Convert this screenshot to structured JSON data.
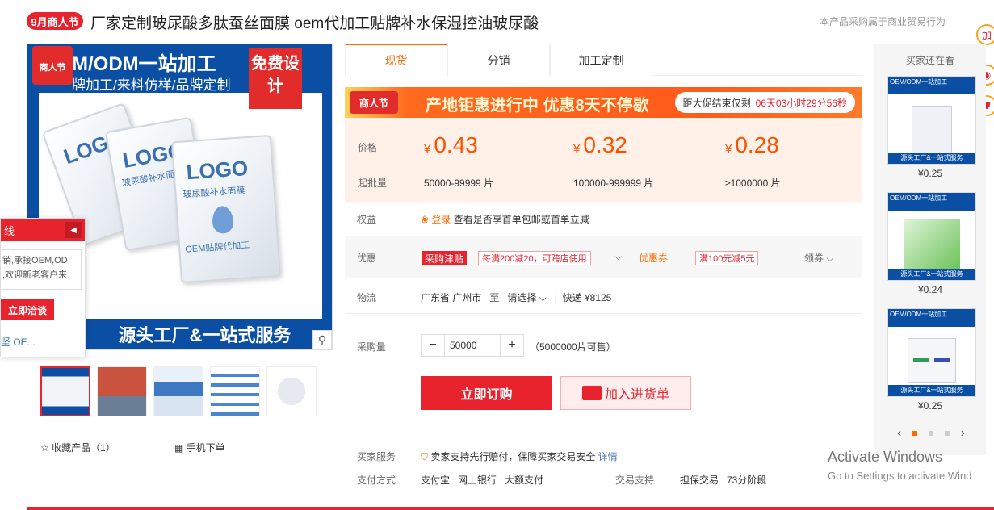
{
  "header": {
    "event_badge": "9月商人节",
    "title": "厂家定制玻尿酸多肽蚕丝面膜 oem代加工贴牌补水保湿控油玻尿酸",
    "trade_note": "本产品采购属于商业贸易行为",
    "float_label": "加"
  },
  "main_image": {
    "badge": "商人节",
    "top_text": "M/ODM一站加工",
    "top_sub": "牌加工/来料仿样/品牌定制",
    "free_text": "免费设计",
    "sachet_logo": "LOGO",
    "sachet_sub": "玻尿酸补水面膜",
    "sachet_oem": "OEM贴牌代加工",
    "bottom_text": "源头工厂&一站式服务"
  },
  "popup": {
    "title": "线",
    "text_line1": "销,承接OEM,OD",
    "text_line2": ",欢迎新老客户来",
    "button": "立即洽谈",
    "footer": "坚 OE..."
  },
  "thumbs": [
    "thumb-1",
    "thumb-2",
    "thumb-3",
    "thumb-4",
    "thumb-5"
  ],
  "actions": {
    "favorite": "收藏产品（1）",
    "mobile_order": "手机下单"
  },
  "tabs": [
    {
      "label": "现货",
      "active": true
    },
    {
      "label": "分销",
      "active": false
    },
    {
      "label": "加工定制",
      "active": false
    }
  ],
  "promo": {
    "badge": "商人节",
    "text": "产地钜惠进行中 优惠8天不停歇",
    "timer_label": "距大促结束仅剩",
    "timer_value": "06天03小时29分56秒"
  },
  "price": {
    "price_label": "价格",
    "qty_label": "起批量",
    "currency": "¥",
    "tiers": [
      {
        "price": "0.43",
        "qty": "50000-99999 片"
      },
      {
        "price": "0.32",
        "qty": "100000-999999 片"
      },
      {
        "price": "0.28",
        "qty": "≥1000000 片"
      }
    ]
  },
  "rights": {
    "label": "权益",
    "link": "登录",
    "text": "查看是否享首单包邮或首单立减"
  },
  "discount": {
    "label": "优惠",
    "tag": "采购津贴",
    "coupon1": "每满200减20，可跨店使用",
    "coupon_label": "优惠券",
    "coupon2": "满100元减5元",
    "claim": "领券"
  },
  "logistics": {
    "label": "物流",
    "from": "广东省 广州市",
    "to_label": "至",
    "to": "请选择",
    "shipping": "快递 ¥8125"
  },
  "quantity": {
    "label": "采购量",
    "value": "50000",
    "stock": "（5000000片可售）"
  },
  "buttons": {
    "buy": "立即订购",
    "cart": "加入进货单"
  },
  "service": {
    "label": "买家服务",
    "text": "卖家支持先行赔付，保障买家交易安全",
    "link": "详情"
  },
  "payment": {
    "label": "支付方式",
    "methods": "支付宝   网上银行   大额支付",
    "support_label": "交易支持",
    "support": "担保交易   73分阶段"
  },
  "recommend": {
    "title": "买家还在看",
    "items": [
      {
        "top": "OEM/ODM一站加工",
        "bottom": "源头工厂&一站式服务",
        "price": "¥0.25"
      },
      {
        "top": "OEM/ODM一站加工",
        "bottom": "源头工厂&一站式服务",
        "price": "¥0.24"
      },
      {
        "top": "OEM/ODM一站加工",
        "bottom": "源头工厂&一站式服务",
        "price": "¥0.25"
      }
    ]
  },
  "watermark": {
    "title": "Activate Windows",
    "sub": "Go to Settings to activate Wind"
  },
  "colors": {
    "brand_red": "#e8232e",
    "accent_orange": "#ff6a00",
    "blue": "#0a4fa3"
  }
}
